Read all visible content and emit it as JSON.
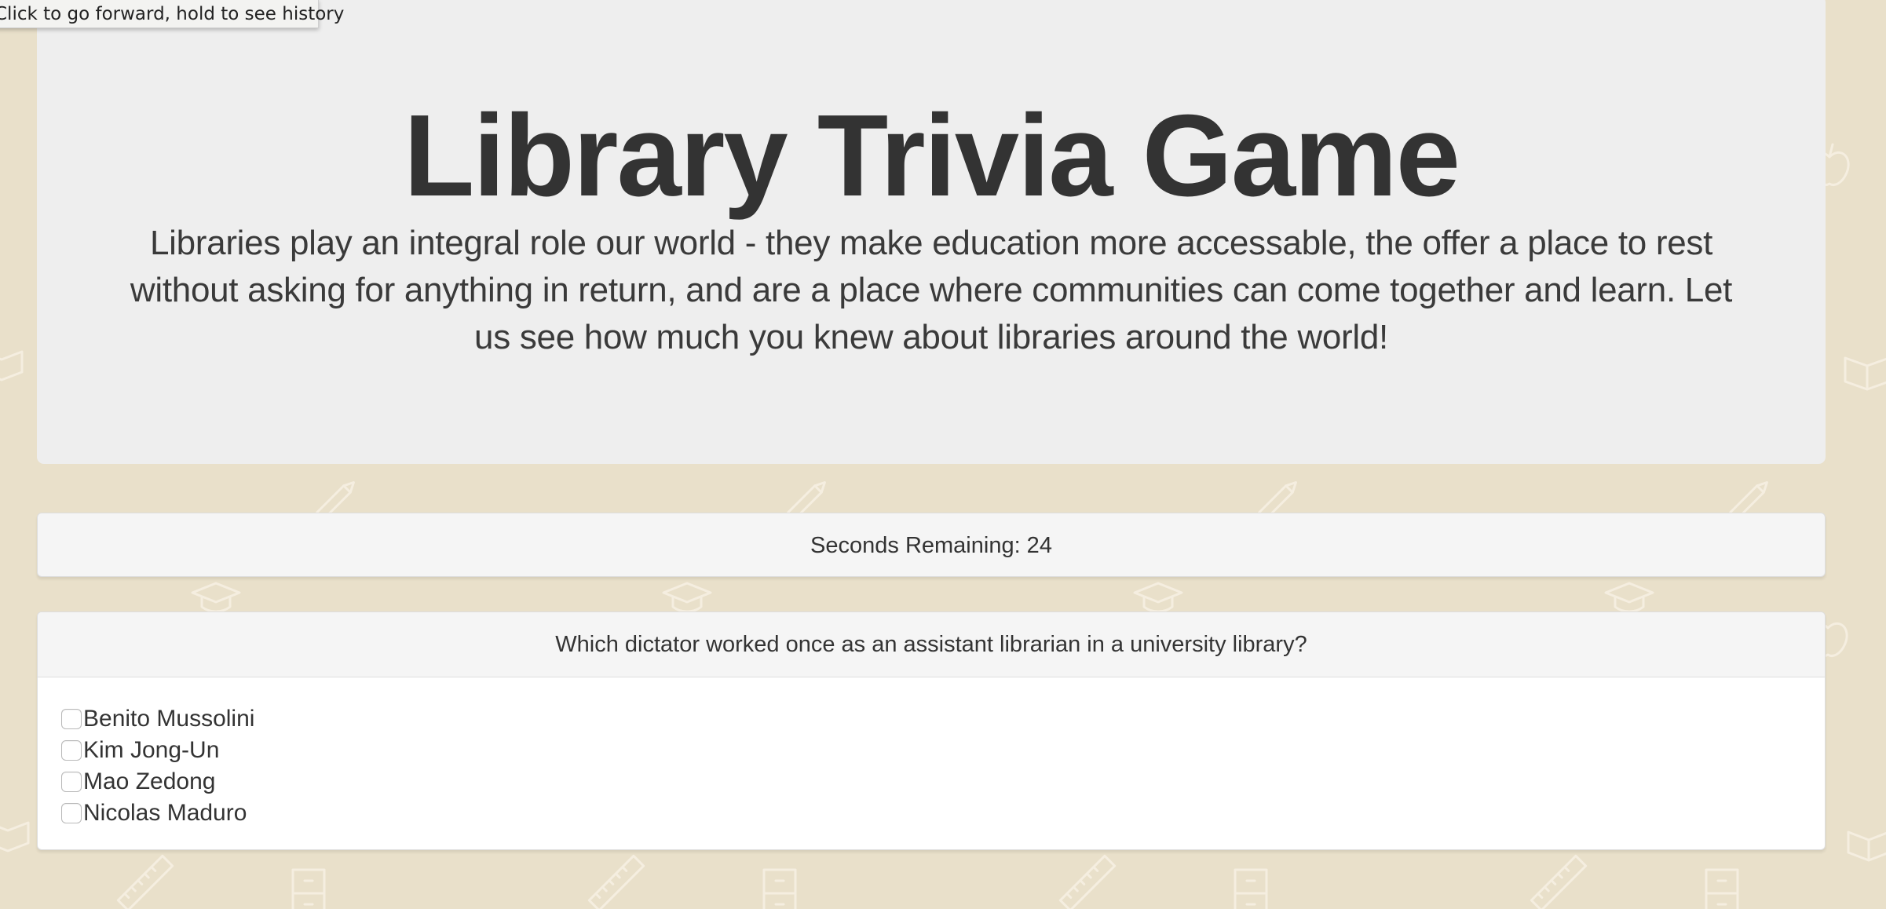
{
  "browser": {
    "tooltip": "Click to go forward, hold to see history"
  },
  "jumbotron": {
    "title": "Library Trivia Game",
    "description": "Libraries play an integral role our world - they make education more accessable, the offer a place to rest without asking for anything in return, and are a place where communities can come together and learn. Let us see how much you knew about libraries around the world!"
  },
  "timer": {
    "text": "Seconds Remaining: 24"
  },
  "question": {
    "text": "Which dictator worked once as an assistant librarian in a university library?",
    "answers": [
      {
        "label": "Benito Mussolini"
      },
      {
        "label": "Kim Jong-Un"
      },
      {
        "label": "Mao Zedong"
      },
      {
        "label": "Nicolas Maduro"
      }
    ]
  },
  "colors": {
    "page_background": "#e9e0ca",
    "pattern_stroke": "#f4ecdc",
    "jumbotron_background": "#eeeeee",
    "panel_heading_background": "#f5f5f5",
    "text": "#333333"
  },
  "icons": [
    "book-icon",
    "pencil-icon",
    "ruler-icon",
    "graduation-cap-icon",
    "file-cabinet-icon",
    "apple-icon"
  ]
}
